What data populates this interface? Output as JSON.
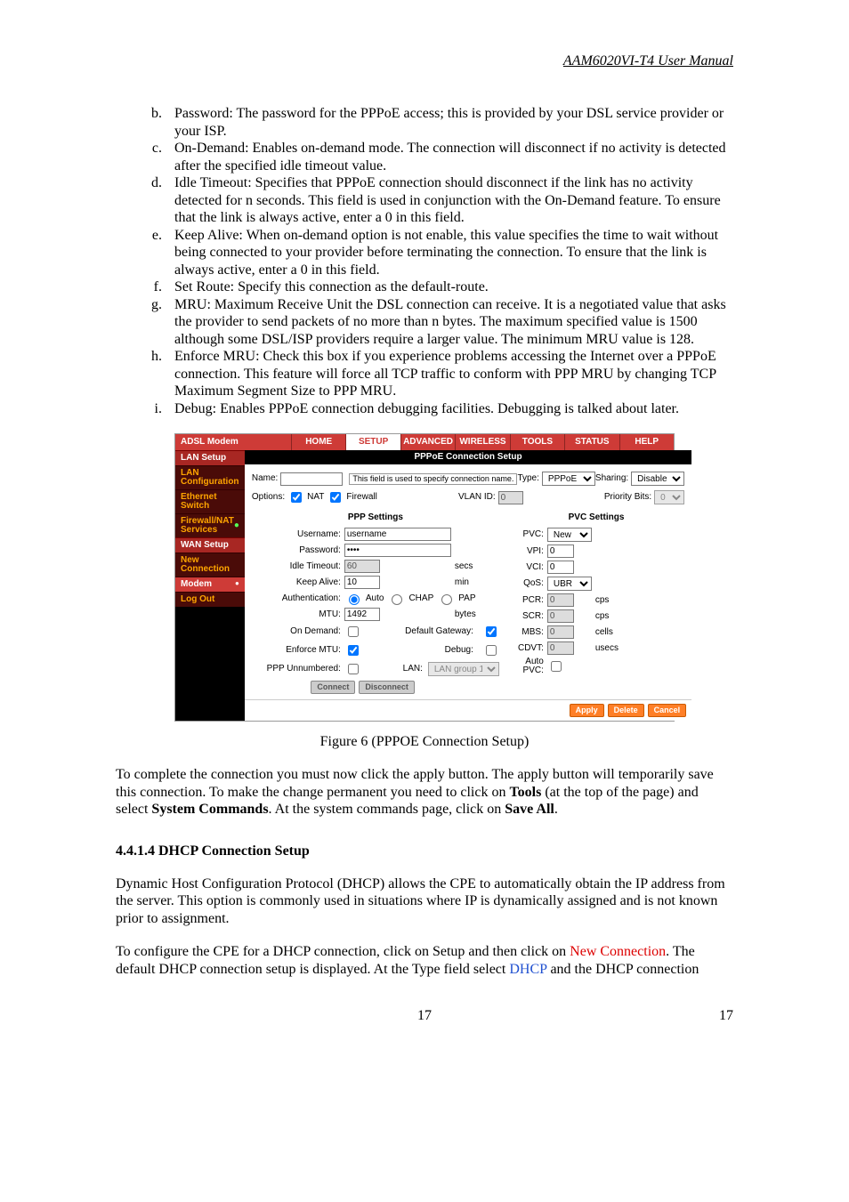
{
  "header": {
    "title": "AAM6020VI-T4 User Manual"
  },
  "list": {
    "start": 2,
    "items": [
      "Password: The password for the PPPoE access; this is provided by your DSL service provider or your ISP.",
      "On-Demand: Enables on-demand mode. The connection will disconnect if no activity is detected after the specified idle timeout value.",
      "Idle Timeout: Specifies that PPPoE connection should disconnect if the link has no activity detected for n seconds.  This field is used in conjunction with the On-Demand feature. To ensure that the link is always active, enter a 0 in this field.",
      "Keep Alive: When on-demand option is not enable, this value specifies the time to wait without being connected to your provider before terminating the connection. To ensure that the link is always active, enter a 0 in this field.",
      "Set Route: Specify this connection as the default-route.",
      "MRU: Maximum Receive Unit the DSL connection can receive. It is a negotiated value that asks the provider to send packets of no more than n bytes. The maximum specified value is 1500 although some DSL/ISP providers require a larger value.  The minimum MRU value is 128.",
      "Enforce MRU: Check this box if you experience problems accessing the Internet over a PPPoE connection. This feature will force all TCP traffic to conform with PPP MRU by changing TCP Maximum Segment Size to PPP MRU.",
      "Debug: Enables PPPoE connection debugging facilities.   Debugging is talked about later."
    ]
  },
  "figure": {
    "caption": "Figure 6 (PPPOE Connection Setup)",
    "ui": {
      "brand": "ADSL Modem",
      "tabs": [
        "HOME",
        "SETUP",
        "ADVANCED",
        "WIRELESS",
        "TOOLS",
        "STATUS",
        "HELP"
      ],
      "active_tab": "SETUP",
      "nav": {
        "lan_head": "LAN Setup",
        "lan_items": [
          "LAN Configuration",
          "Ethernet Switch"
        ],
        "fw_item": "Firewall/NAT Services",
        "wan_head": "WAN Setup",
        "wan_items": [
          "New Connection",
          "Modem"
        ],
        "logout": "Log Out"
      },
      "title": "PPPoE Connection Setup",
      "top": {
        "name_lbl": "Name:",
        "name_val": "",
        "hint": "This field is used to specify connection name.",
        "type_lbl": "Type:",
        "type_val": "PPPoE",
        "sharing_lbl": "Sharing:",
        "sharing_val": "Disable",
        "opts_lbl": "Options:",
        "nat_lbl": "NAT",
        "fw_lbl": "Firewall",
        "vlan_lbl": "VLAN ID:",
        "vlan_val": "0",
        "pri_lbl": "Priority Bits:",
        "pri_val": "0"
      },
      "ppp": {
        "title": "PPP Settings",
        "user_lbl": "Username:",
        "user_val": "username",
        "pass_lbl": "Password:",
        "pass_val": "••••",
        "idle_lbl": "Idle Timeout:",
        "idle_val": "60",
        "idle_unit": "secs",
        "keep_lbl": "Keep Alive:",
        "keep_val": "10",
        "keep_unit": "min",
        "auth_lbl": "Authentication:",
        "auth_auto": "Auto",
        "auth_chap": "CHAP",
        "auth_pap": "PAP",
        "mtu_lbl": "MTU:",
        "mtu_val": "1492",
        "mtu_unit": "bytes",
        "ond_lbl": "On Demand:",
        "defgw_lbl": "Default Gateway:",
        "enf_lbl": "Enforce MTU:",
        "dbg_lbl": "Debug:",
        "unnum_lbl": "PPP Unnumbered:",
        "lan_lbl": "LAN:",
        "lan_val": "LAN group 1"
      },
      "pvc": {
        "title": "PVC Settings",
        "pvc_lbl": "PVC:",
        "pvc_val": "New",
        "vpi_lbl": "VPI:",
        "vpi_val": "0",
        "vci_lbl": "VCI:",
        "vci_val": "0",
        "qos_lbl": "QoS:",
        "qos_val": "UBR",
        "pcr_lbl": "PCR:",
        "pcr_val": "0",
        "cps": "cps",
        "scr_lbl": "SCR:",
        "scr_val": "0",
        "mbs_lbl": "MBS:",
        "mbs_val": "0",
        "cells": "cells",
        "cdvt_lbl": "CDVT:",
        "cdvt_val": "0",
        "usecs": "usecs",
        "auto_lbl": "Auto PVC:"
      },
      "btns": {
        "connect": "Connect",
        "disconnect": "Disconnect",
        "apply": "Apply",
        "delete": "Delete",
        "cancel": "Cancel"
      }
    }
  },
  "para1": {
    "pre": "To complete the connection you must now click the apply button.  The apply button will temporarily save this connection. To make the change permanent you need to click on ",
    "tools": "Tools",
    "mid": " (at the top of the page) and select ",
    "syscmd": "System Commands",
    "post": ".  At the system commands page, click on ",
    "saveall": "Save All",
    "end": "."
  },
  "section": {
    "heading": "4.4.1.4 DHCP Connection Setup"
  },
  "para2": "Dynamic Host Configuration Protocol (DHCP) allows the CPE to automatically obtain the IP address from the server. This option is commonly used in situations where IP is dynamically assigned and is not known prior to assignment.",
  "para3": {
    "pre": "To configure the CPE for a DHCP connection, click on Setup and then click on ",
    "newconn": "New Connection",
    "mid": ".  The default DHCP connection setup is displayed.  At the Type field select ",
    "dhcp": "DHCP",
    "post": " and the DHCP connection"
  },
  "footer": {
    "left": "17",
    "right": "17"
  }
}
